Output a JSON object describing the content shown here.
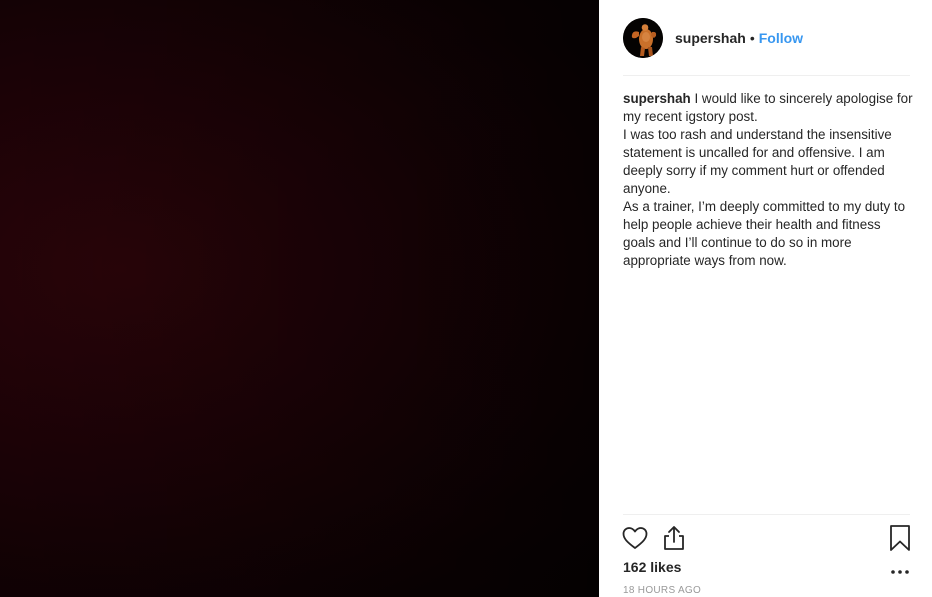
{
  "post": {
    "author": {
      "username": "supershah",
      "separator": "•",
      "follow_label": "Follow",
      "avatar_icon": "bodybuilder-avatar-icon"
    },
    "caption": {
      "username": "supershah",
      "first_line": "I would like to sincerely apologise for my recent igstory post.",
      "paragraph_2": "I was too rash and understand the insensitive statement is uncalled for and offensive. I am deeply sorry if my comment hurt or offended anyone.",
      "paragraph_3": "As a trainer, I’m deeply committed to my duty to help people achieve their health and fitness goals and I’ll continue to do so in more appropriate ways from now."
    },
    "actions": {
      "like_icon": "heart-icon",
      "share_icon": "share-icon",
      "save_icon": "bookmark-icon",
      "more_icon": "more-options-icon"
    },
    "likes": "162 likes",
    "timestamp": "18 HOURS AGO",
    "colors": {
      "follow": "#3897f0",
      "text": "#262626",
      "muted": "#999999",
      "media_bg": "#1a0206"
    }
  }
}
